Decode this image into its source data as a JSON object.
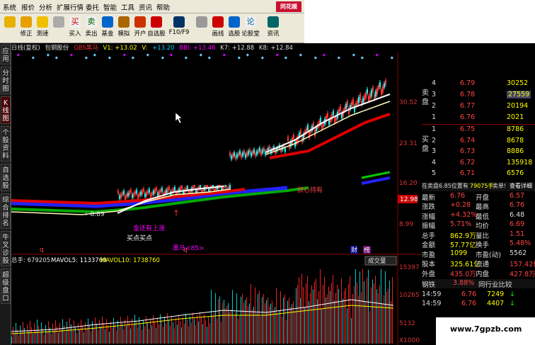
{
  "menu": [
    "系统",
    "报价",
    "分析",
    "扩展行情",
    "委托",
    "智能",
    "工具",
    "资讯",
    "帮助"
  ],
  "logo": "同花顺",
  "toolbar": [
    {
      "label": "",
      "icon": "back-icon",
      "color": "#e8b000"
    },
    {
      "label": "修正",
      "icon": "fix-icon",
      "color": "#e8a000"
    },
    {
      "label": "测速",
      "icon": "speed-icon",
      "color": "#f0c000"
    },
    {
      "label": "",
      "icon": "clock-icon",
      "color": "#aaa"
    },
    {
      "label": "买入",
      "icon": "buy-icon",
      "color": "#c00",
      "glyph": "买"
    },
    {
      "label": "卖出",
      "icon": "sell-icon",
      "color": "#060",
      "glyph": "卖"
    },
    {
      "label": "基金",
      "icon": "fund-icon",
      "color": "#06c"
    },
    {
      "label": "模拟",
      "icon": "simulate-icon",
      "color": "#a60"
    },
    {
      "label": "开户",
      "icon": "account-icon",
      "color": "#c30"
    },
    {
      "label": "自选股",
      "icon": "watchlist-icon",
      "color": "#c00"
    },
    {
      "label": "F10/F9",
      "icon": "f10-icon",
      "color": "#036"
    },
    {
      "label": "",
      "icon": "grid-icon",
      "color": "#999"
    },
    {
      "label": "画线",
      "icon": "draw-line-icon",
      "color": "#c00"
    },
    {
      "label": "选股",
      "icon": "pick-stock-icon",
      "color": "#06c"
    },
    {
      "label": "论股堂",
      "icon": "forum-icon",
      "color": "#069",
      "glyph": "论"
    },
    {
      "label": "资讯",
      "icon": "news-icon",
      "color": "#066"
    }
  ],
  "sidetabs": [
    {
      "label": "应用",
      "active": false
    },
    {
      "label": "分时图",
      "active": false
    },
    {
      "label": "K线图",
      "active": true
    },
    {
      "label": "个股资料",
      "active": false
    },
    {
      "label": "自选股",
      "active": false
    },
    {
      "label": "综合排名",
      "active": false
    },
    {
      "label": "牛叉诊股",
      "active": false
    },
    {
      "label": "超级盘口",
      "active": false
    }
  ],
  "infobar": {
    "a": "日线(复权)",
    "b": "包钢股份",
    "c": "GBS黑马",
    "d": "V1: +13.02",
    "e": "V:",
    "f": "+13.20",
    "g": "BBI: +13.46",
    "h": "K7: +12.88",
    "i": "K8: +12.84"
  },
  "chart": {
    "price_labels": [
      "30.52",
      "23.31",
      "16.20",
      "12.98",
      "8.99"
    ],
    "vol_labels": [
      "15397",
      "10265",
      "5132",
      "X1000"
    ],
    "annot": {
      "low": "←8.89",
      "jin": "金还有上涨",
      "buy": "买点买点",
      "heima": "黑马<85>",
      "focus": "放心持有",
      "q1": "q",
      "q2": "q",
      "cai": "财",
      "bang": "榜"
    },
    "vol_header": {
      "a": "总手: 679205",
      "b": "MAVOL5: 1133769",
      "c": "MAVOL10: 1738760"
    },
    "vol_btn": "成交量"
  },
  "quotes": {
    "sell_label": "卖盘",
    "buy_label": "买盘",
    "sell": [
      {
        "lvl": "4",
        "price": "6.79",
        "vol": "30252"
      },
      {
        "lvl": "3",
        "price": "6.78",
        "vol": "27559"
      },
      {
        "lvl": "2",
        "price": "6.77",
        "vol": "20194"
      },
      {
        "lvl": "1",
        "price": "6.76",
        "vol": "2021"
      }
    ],
    "buy": [
      {
        "lvl": "1",
        "price": "6.75",
        "vol": "8786"
      },
      {
        "lvl": "2",
        "price": "6.74",
        "vol": "8678"
      },
      {
        "lvl": "3",
        "price": "6.73",
        "vol": "8886"
      },
      {
        "lvl": "4",
        "price": "6.72",
        "vol": "135918"
      },
      {
        "lvl": "5",
        "price": "6.71",
        "vol": "6576"
      }
    ],
    "notice": {
      "a": "在卖盘6.85位置有",
      "b": "79075手",
      "c": "卖单!",
      "d": "查看详细"
    },
    "stats": [
      {
        "l1": "最新",
        "v1": "6.76",
        "l2": "开盘",
        "v2": "6.57"
      },
      {
        "l1": "涨跌",
        "v1": "+0.28",
        "l2": "最高",
        "v2": "6.76"
      },
      {
        "l1": "涨幅",
        "v1": "+4.32%",
        "l2": "最低",
        "v2": "6.48"
      },
      {
        "l1": "振幅",
        "v1": "5.71%",
        "l2": "均价",
        "v2": "6.69"
      },
      {
        "l1": "总手",
        "v1": "862.9万",
        "l2": "量比",
        "v2": "1.51"
      },
      {
        "l1": "金额",
        "v1": "57.77亿",
        "l2": "换手",
        "v2": "5.48%"
      },
      {
        "l1": "市盈",
        "v1": "1099",
        "l2": "市盈(动)",
        "v2": "5562"
      },
      {
        "l1": "股本",
        "v1": "325.61亿",
        "l2": "流通",
        "v2": "157.42亿"
      },
      {
        "l1": "外盘",
        "v1": "435.0万",
        "l2": "内盘",
        "v2": "427.8万"
      }
    ],
    "sector": {
      "a": "钢铁",
      "b": "3.88%",
      "c": "同行业比较"
    },
    "ticks": [
      {
        "t": "14:59",
        "p": "6.76",
        "v": "7249"
      },
      {
        "t": "14:59",
        "p": "6.76",
        "v": "4407"
      }
    ]
  },
  "watermark": "www.7gpzb.com"
}
